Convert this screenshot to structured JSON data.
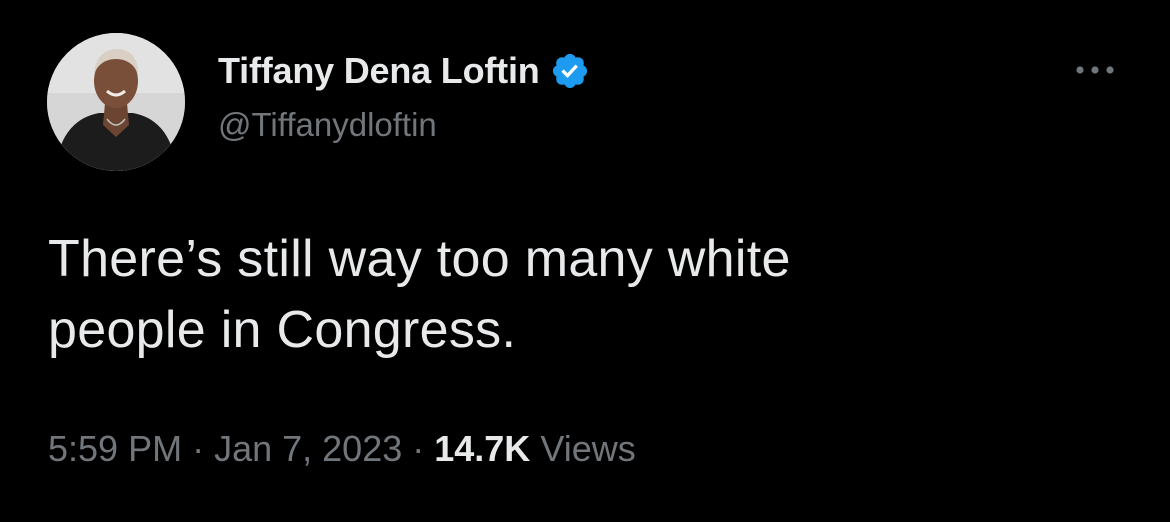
{
  "author": {
    "display_name": "Tiffany Dena Loftin",
    "handle": "@Tiffanydloftin",
    "verified_icon": "verified-badge-icon"
  },
  "tweet": {
    "line1": "There’s still way too many white",
    "line2": "people in Congress."
  },
  "meta": {
    "time": "5:59 PM",
    "separator": "·",
    "date": "Jan 7, 2023",
    "views_count": "14.7K",
    "views_label": "Views"
  },
  "colors": {
    "background": "#000000",
    "primary_text": "#e7e9ea",
    "secondary_text": "#71767b",
    "verified_blue": "#1d9bf0"
  },
  "icons": {
    "more": "more-options-icon",
    "avatar": "avatar"
  }
}
